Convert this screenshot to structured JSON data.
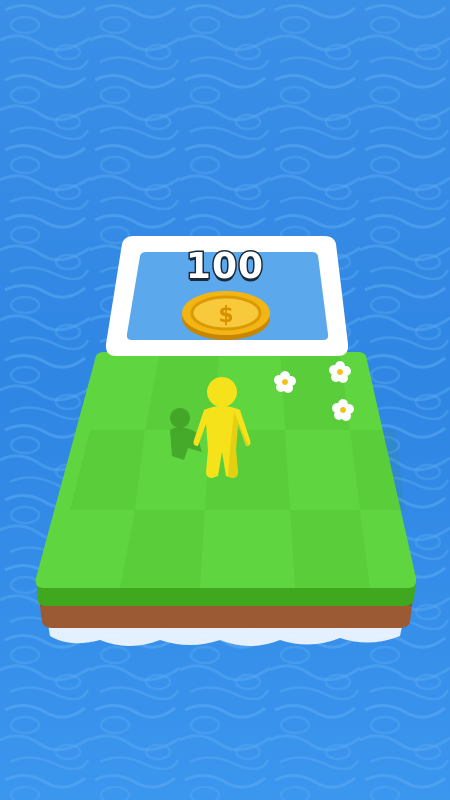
{
  "game": {
    "unlock_tile": {
      "cost": "100",
      "currency_icon": "dollar-coin-icon"
    },
    "island": {
      "decorations": [
        "flower-icon",
        "flower-icon",
        "flower-icon"
      ]
    },
    "player": {
      "icon": "stickman-character",
      "color": "#f5e21a"
    },
    "colors": {
      "water": "#2f86e3",
      "grass": "#5fd63f",
      "dirt": "#9c5a34",
      "coin": "#f3b514"
    }
  }
}
